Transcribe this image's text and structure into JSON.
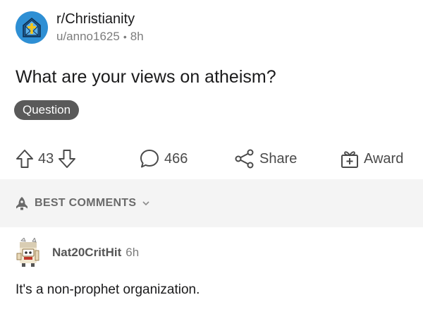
{
  "post": {
    "subreddit": "r/Christianity",
    "author": "u/anno1625",
    "separator": "•",
    "age": "8h",
    "title": "What are your views on atheism?",
    "flair": "Question"
  },
  "actions": {
    "vote_count": "43",
    "comment_count": "466",
    "share_label": "Share",
    "award_label": "Award"
  },
  "sort": {
    "label": "BEST COMMENTS"
  },
  "comment": {
    "author": "Nat20CritHit",
    "age": "6h",
    "body": "It's a non-prophet organization."
  },
  "colors": {
    "subreddit_icon_bg": "#2e8fd4",
    "flair_bg": "#5a5a5a",
    "sort_bar_bg": "#f4f4f4",
    "action_color": "#4a4a4a"
  },
  "icons": [
    "subreddit-icon",
    "upvote-icon",
    "downvote-icon",
    "comment-icon",
    "share-icon",
    "award-icon",
    "sort-rocket-icon",
    "chevron-down-icon",
    "user-avatar"
  ]
}
